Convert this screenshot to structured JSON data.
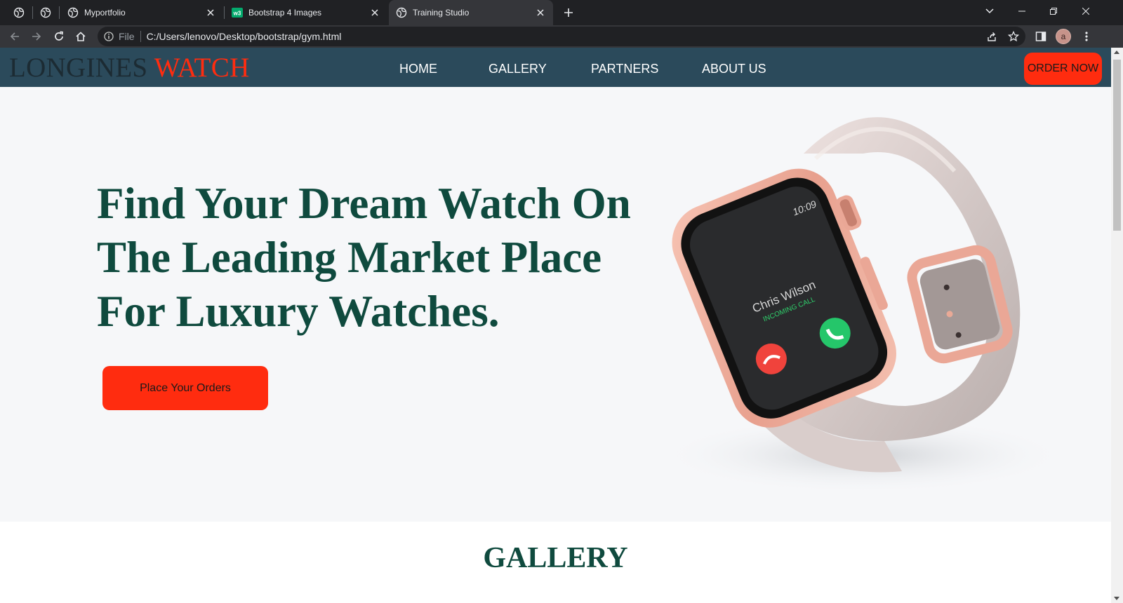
{
  "browser": {
    "tabs": [
      {
        "title": "Myportfolio",
        "icon": "globe-icon"
      },
      {
        "title": "Bootstrap 4 Images",
        "icon": "w3schools-icon"
      },
      {
        "title": "Training Studio",
        "icon": "globe-icon",
        "active": true
      }
    ],
    "omnibox": {
      "scheme_label": "File",
      "url": "C:/Users/lenovo/Desktop/bootstrap/gym.html"
    },
    "profile_initial": "a"
  },
  "site": {
    "brand": {
      "part1": "LONGINES ",
      "part2": "WATCH"
    },
    "nav": [
      {
        "label": "HOME"
      },
      {
        "label": "GALLERY"
      },
      {
        "label": "PARTNERS"
      },
      {
        "label": "ABOUT US"
      }
    ],
    "order_button": "ORDER NOW",
    "hero": {
      "headline": "Find Your Dream Watch On The Leading Market Place For Luxury Watches.",
      "cta_label": "Place Your Orders",
      "watch_screen": {
        "time": "10:09",
        "caller": "Chris Wilson",
        "status": "INCOMING CALL"
      }
    },
    "section_title": "GALLERY"
  },
  "colors": {
    "nav_bg": "#2b4a5b",
    "accent": "#ff2c0f",
    "headline": "#0f4a3e",
    "hero_bg": "#f6f7f9"
  }
}
